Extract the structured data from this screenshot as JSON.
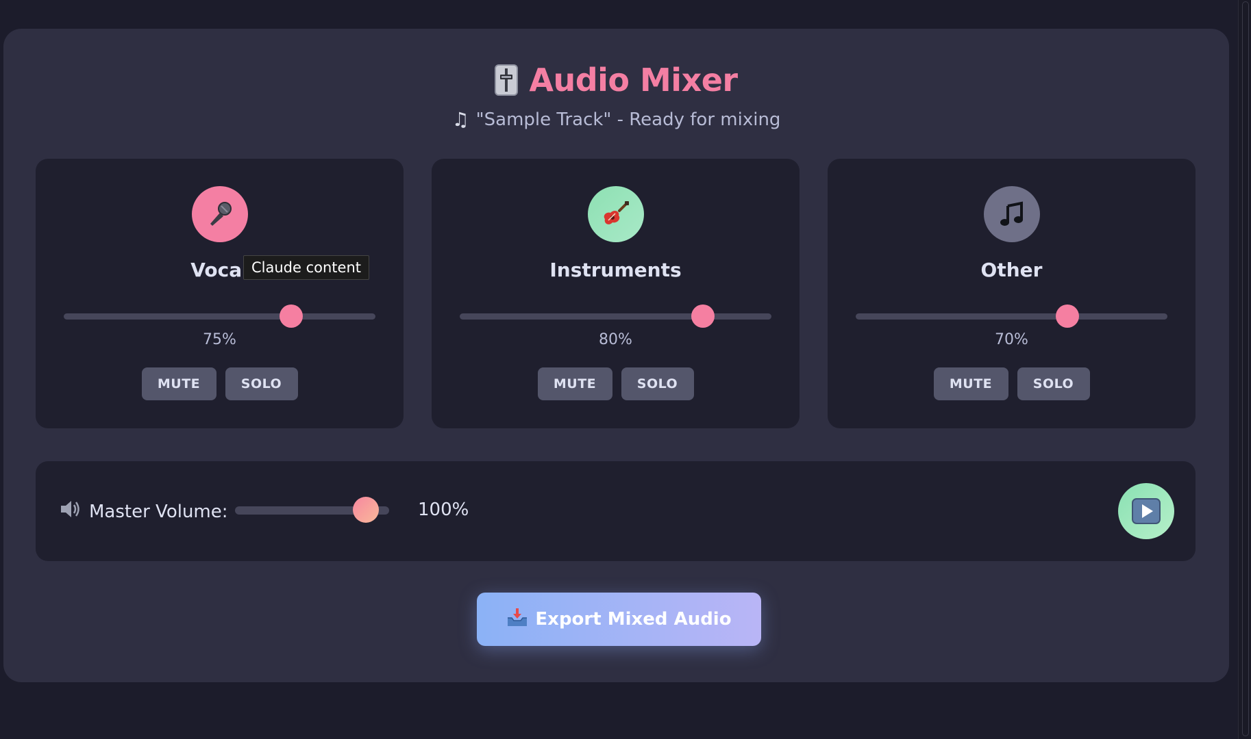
{
  "app": {
    "title": "Audio Mixer",
    "subtitle": "\"Sample Track\" - Ready for mixing"
  },
  "channels": [
    {
      "name": "Vocal",
      "icon": "microphone-icon",
      "icon_bg": "#f47fa3",
      "volume": 0.75,
      "value_label": "75%",
      "mute_label": "MUTE",
      "solo_label": "SOLO"
    },
    {
      "name": "Instruments",
      "icon": "guitar-icon",
      "icon_bg": "#8fe0b6",
      "volume": 0.8,
      "value_label": "80%",
      "mute_label": "MUTE",
      "solo_label": "SOLO"
    },
    {
      "name": "Other",
      "icon": "music-note-icon",
      "icon_bg": "#6f7088",
      "volume": 0.7,
      "value_label": "70%",
      "mute_label": "MUTE",
      "solo_label": "SOLO"
    }
  ],
  "tooltip": "Claude content",
  "master": {
    "label": "Master Volume:",
    "volume": 1.0,
    "value_label": "100%"
  },
  "export": {
    "label": "Export Mixed Audio"
  },
  "colors": {
    "accent": "#f47fa3",
    "panel": "#2f2f42",
    "card": "#1f1f2e",
    "button": "#54566b"
  }
}
